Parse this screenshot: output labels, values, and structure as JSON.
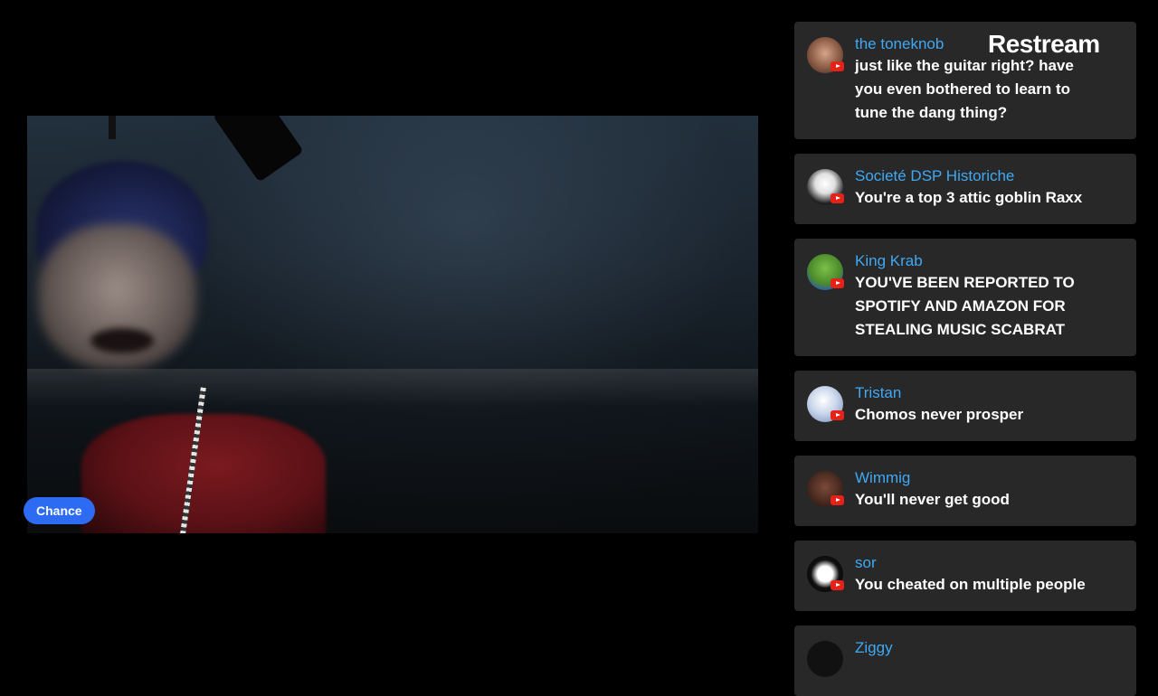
{
  "stream": {
    "participant_name": "Chance",
    "brand": "Restream"
  },
  "chat": {
    "messages": [
      {
        "user": "the toneknob",
        "text": "just like the guitar right? have you even bothered to learn to tune the dang thing?",
        "platform": "youtube"
      },
      {
        "user": "Societé DSP Historiche",
        "text": "You're a top 3 attic goblin Raxx",
        "platform": "youtube"
      },
      {
        "user": "King Krab",
        "text": "YOU'VE BEEN REPORTED TO SPOTIFY AND AMAZON FOR STEALING MUSIC SCABRAT",
        "platform": "youtube"
      },
      {
        "user": "Tristan",
        "text": "Chomos never prosper",
        "platform": "youtube"
      },
      {
        "user": "Wimmig",
        "text": "You'll never get good",
        "platform": "youtube"
      },
      {
        "user": "sor",
        "text": "You cheated on multiple people",
        "platform": "youtube"
      },
      {
        "user": "Ziggy",
        "text": "",
        "platform": "youtube"
      }
    ]
  },
  "colors": {
    "username": "#3fa9f5",
    "message_bg": "#282828",
    "name_tag": "#2d6cf2",
    "youtube_badge": "#e62117"
  }
}
